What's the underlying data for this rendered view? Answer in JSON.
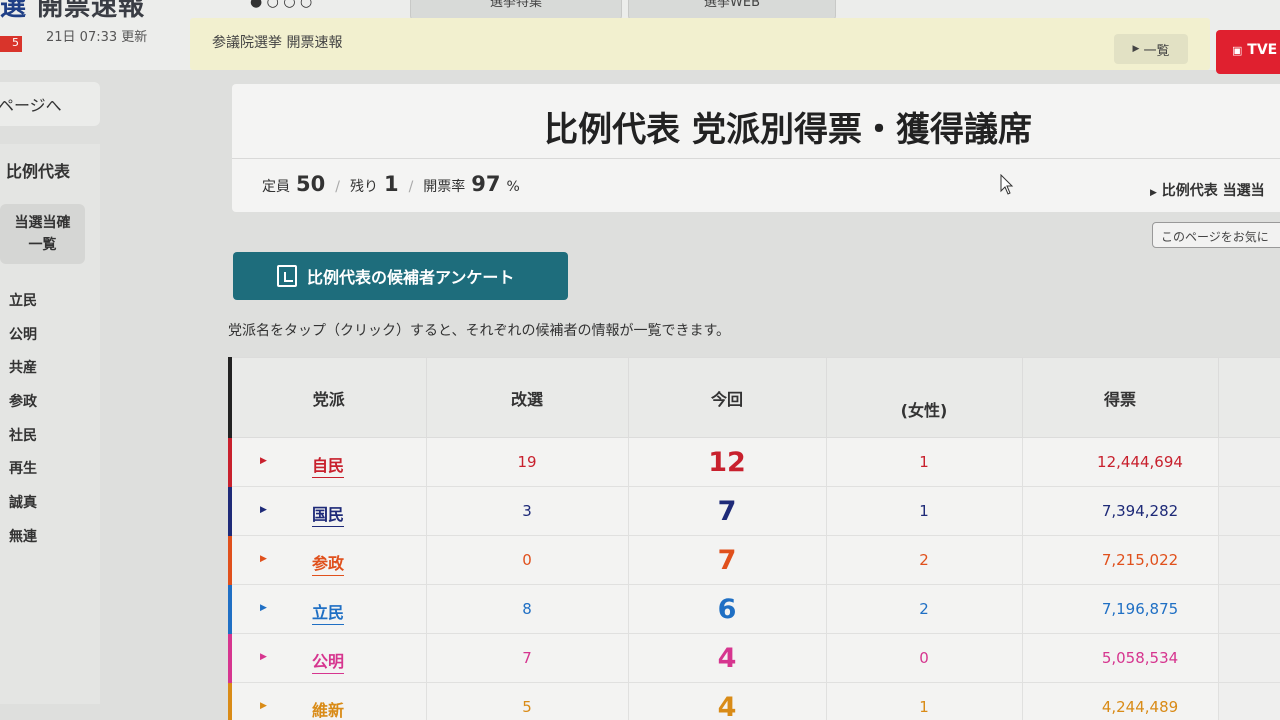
{
  "header": {
    "site_title": "選 開票速報",
    "site_title_first": "選",
    "site_title_rest": "開票速報",
    "badge": "5",
    "updated": "21日 07:33 更新",
    "tab1": "選挙特集",
    "tab2": "選挙WEB",
    "ticker": "参議院選挙 開票速報",
    "list_button": "一覧",
    "tv_button": "TVE"
  },
  "sidebar": {
    "back": "ページへ",
    "section": "比例代表",
    "winners_button_line1": "当選当確",
    "winners_button_line2": "一覧",
    "parties": [
      "立民",
      "公明",
      "共産",
      "参政",
      "社民",
      "再生",
      "誠真",
      "無連"
    ]
  },
  "main": {
    "title": "比例代表 党派別得票・獲得議席",
    "quota_label": "定員",
    "quota_value": "50",
    "remaining_label": "残り",
    "remaining_value": "1",
    "count_rate_label": "開票率",
    "count_rate_value": "97",
    "count_rate_unit": "%",
    "sub_link": "比例代表 当選当",
    "favorite_button": "このページをお気に",
    "survey_button": "比例代表の候補者アンケート",
    "note": "党派名をタップ（クリック）すると、それぞれの候補者の情報が一覧できます。"
  },
  "table": {
    "headers": {
      "party": "党派",
      "up_for_election": "改選",
      "current": "今回",
      "female": "(女性)",
      "votes": "得票"
    },
    "rows": [
      {
        "party": "自民",
        "color": "#c8202d",
        "up": "19",
        "current": "12",
        "female": "1",
        "votes": "12,444,694"
      },
      {
        "party": "国民",
        "color": "#1e2a78",
        "up": "3",
        "current": "7",
        "female": "1",
        "votes": "7,394,282"
      },
      {
        "party": "参政",
        "color": "#e0501c",
        "up": "0",
        "current": "7",
        "female": "2",
        "votes": "7,215,022"
      },
      {
        "party": "立民",
        "color": "#1f6fc4",
        "up": "8",
        "current": "6",
        "female": "2",
        "votes": "7,196,875"
      },
      {
        "party": "公明",
        "color": "#d6358f",
        "up": "7",
        "current": "4",
        "female": "0",
        "votes": "5,058,534"
      },
      {
        "party": "維新",
        "color": "#d98b17",
        "up": "5",
        "current": "4",
        "female": "1",
        "votes": "4,244,489"
      }
    ]
  },
  "colors": {
    "accent_teal": "#1e6d7c",
    "ticker_bg": "#f2f0cf",
    "tv_red": "#e0202f"
  }
}
